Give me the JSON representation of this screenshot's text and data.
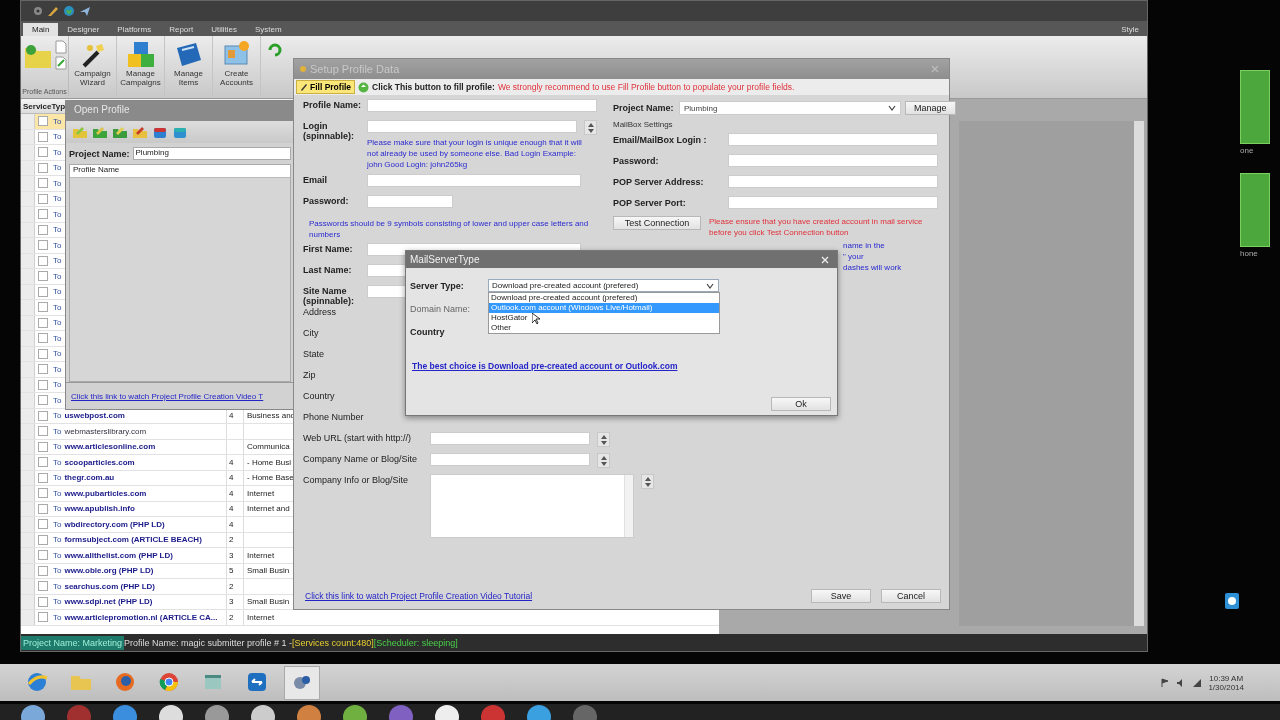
{
  "app": {
    "tabs": [
      {
        "label": "Main",
        "selected": true
      },
      {
        "label": "Designer",
        "selected": false
      },
      {
        "label": "Platforms",
        "selected": false
      },
      {
        "label": "Report",
        "selected": false
      },
      {
        "label": "Utilities",
        "selected": false
      },
      {
        "label": "System",
        "selected": false
      }
    ],
    "style_label": "Style",
    "ribbon": {
      "group_label": "Profile Actions",
      "buttons": [
        {
          "label": "Campaign Wizard"
        },
        {
          "label": "Manage Campaigns"
        },
        {
          "label": "Manage Items"
        },
        {
          "label": "Create Accounts"
        }
      ]
    },
    "grid": {
      "column_1": "ServiceTyp",
      "rows": [
        {
          "prefix": "To",
          "checked": false,
          "selected": true
        },
        {
          "prefix": "To",
          "checked": false,
          "selected": false
        },
        {
          "prefix": "To",
          "checked": false,
          "selected": false
        },
        {
          "prefix": "To",
          "checked": false,
          "selected": false
        },
        {
          "prefix": "To",
          "checked": false,
          "selected": false
        },
        {
          "prefix": "To",
          "checked": false,
          "selected": false
        },
        {
          "prefix": "To",
          "checked": false,
          "selected": false
        },
        {
          "prefix": "To",
          "checked": false,
          "selected": false
        },
        {
          "prefix": "To",
          "checked": false,
          "selected": false
        },
        {
          "prefix": "To",
          "checked": false,
          "selected": false
        },
        {
          "prefix": "To",
          "checked": false,
          "selected": false
        },
        {
          "prefix": "To",
          "checked": false,
          "selected": false
        },
        {
          "prefix": "To",
          "checked": false,
          "selected": false
        },
        {
          "prefix": "To",
          "checked": false,
          "selected": false
        },
        {
          "prefix": "To",
          "checked": false,
          "selected": false
        },
        {
          "prefix": "To",
          "checked": false,
          "selected": false
        },
        {
          "prefix": "To",
          "checked": false,
          "selected": false
        },
        {
          "prefix": "To",
          "checked": false,
          "selected": false
        },
        {
          "prefix": "To",
          "checked": false,
          "selected": false
        },
        {
          "prefix": "To",
          "name": "uswebpost.com",
          "bold": true,
          "count": "4",
          "category": "Business and",
          "checked": false,
          "selected": false
        },
        {
          "prefix": "To",
          "name": "webmasterslibrary.com",
          "bold": false,
          "checked": false,
          "selected": false
        },
        {
          "prefix": "To",
          "name": "www.articlesonline.com",
          "bold": true,
          "category": "Communica",
          "checked": false,
          "selected": false
        },
        {
          "prefix": "To",
          "name": "scooparticles.com",
          "bold": true,
          "count": "4",
          "category": "- Home Busi",
          "checked": false,
          "selected": false
        },
        {
          "prefix": "To",
          "name": "thegr.com.au",
          "bold": true,
          "count": "4",
          "category": "- Home Base",
          "checked": false,
          "selected": false
        },
        {
          "prefix": "To",
          "name": "www.pubarticles.com",
          "bold": true,
          "count": "4",
          "category": "Internet",
          "checked": false,
          "selected": false
        },
        {
          "prefix": "To",
          "name": "www.apublish.info",
          "bold": true,
          "count": "4",
          "category": "Internet and",
          "checked": false,
          "selected": false
        },
        {
          "prefix": "To",
          "name": "wbdirectory.com (PHP LD)",
          "bold": true,
          "count": "4",
          "checked": false,
          "selected": false
        },
        {
          "prefix": "To",
          "name": "formsubject.com (ARTICLE BEACH)",
          "bold": true,
          "count": "2",
          "checked": false,
          "selected": false
        },
        {
          "prefix": "To",
          "name": "www.allthelist.com (PHP LD)",
          "bold": true,
          "count": "3",
          "category": "Internet",
          "checked": false,
          "selected": false
        },
        {
          "prefix": "To",
          "name": "www.oble.org (PHP LD)",
          "bold": true,
          "count": "5",
          "category": "Small Busin",
          "checked": false,
          "selected": false
        },
        {
          "prefix": "To",
          "name": "searchus.com (PHP LD)",
          "bold": true,
          "count": "2",
          "checked": false,
          "selected": false
        },
        {
          "prefix": "To",
          "name": "www.sdpi.net (PHP LD)",
          "bold": true,
          "count": "3",
          "category": "Small Busin",
          "checked": false,
          "selected": false
        },
        {
          "prefix": "To",
          "name": "www.articlepromotion.nl (ARTICLE CA...",
          "bold": true,
          "count": "2",
          "category": "Internet",
          "checked": false,
          "selected": false
        }
      ]
    },
    "status_bar": {
      "project": "Project Name: Marketing",
      "profile": "Profile Name: magic submitter profile # 1 - ",
      "services": "[Services count:480]",
      "scheduler": "[Scheduler: sleeping]"
    }
  },
  "open_profile": {
    "title": "Open Profile",
    "project_label": "Project Name:",
    "project_value": "Plumbing",
    "list_header": "Profile Name",
    "link": "Click this link to watch Project  Profile Creation Video T"
  },
  "setup_profile": {
    "title": "Setup Profile Data",
    "fill_button": "Fill Profile",
    "fill_hint": "Click This button to fill profile:",
    "warning": "We strongly recommend to use Fill Profile button to populate your profile fields.",
    "left_fields": [
      {
        "kind": "text",
        "label": "Profile Name:",
        "bold": true
      },
      {
        "kind": "spin",
        "label": "Login (spinnable):",
        "bold": true,
        "note": "Please make sure that your login is unique enough that it will not already be used by someone else. Bad Login Example: john Good Login: john265kg"
      },
      {
        "kind": "text",
        "label": "Email",
        "bold": true
      },
      {
        "kind": "short",
        "label": "Password:",
        "bold": true
      },
      {
        "kind": "note",
        "label": "Passwords should be 9 symbols consisting of lower and upper case letters and numbers"
      },
      {
        "kind": "text",
        "label": "First Name:",
        "bold": true
      },
      {
        "kind": "text",
        "label": "Last Name:",
        "bold": true
      },
      {
        "kind": "text",
        "label": "Site Name (spinnable):",
        "bold": true
      },
      {
        "kind": "label",
        "label": "Address",
        "bold": false
      },
      {
        "kind": "label",
        "label": "City",
        "bold": false
      },
      {
        "kind": "label",
        "label": "State",
        "bold": false
      },
      {
        "kind": "label",
        "label": "Zip",
        "bold": false
      },
      {
        "kind": "label",
        "label": "Country",
        "bold": false
      },
      {
        "kind": "label",
        "label": "Phone Number",
        "bold": false
      },
      {
        "kind": "url",
        "label": "Web URL (start with http://)",
        "bold": false
      },
      {
        "kind": "url",
        "label": "Company Name or Blog/Site",
        "bold": false
      },
      {
        "kind": "textarea",
        "label": "Company Info or Blog/Site",
        "bold": false
      }
    ],
    "project_label": "Project Name:",
    "project_value": "Plumbing",
    "manage_button": "Manage",
    "mailbox_heading": "MailBox Settings",
    "mail_fields": [
      {
        "label": "Email/MailBox Login :"
      },
      {
        "label": "Password:"
      },
      {
        "label": "POP Server Address:"
      },
      {
        "label": "POP Server Port:"
      }
    ],
    "test_button": "Test Connection",
    "test_note": "Please ensure that you have created account in mail service before you click Test Connection button",
    "hidden_fragments": [
      "name in the",
      "\" your",
      "dashes will work"
    ],
    "link": "Click this link to watch Project  Profile Creation Video Tutorial",
    "save_button": "Save",
    "cancel_button": "Cancel"
  },
  "mail_dialog": {
    "title": "MailServerType",
    "server_label": "Server Type:",
    "server_value": "Download pre-created account (prefered)",
    "options": [
      {
        "label": "Download pre-created account (prefered)",
        "selected": false
      },
      {
        "label": "Outlook.com account (Windows Live/Hotmail)",
        "selected": true
      },
      {
        "label": "HostGator",
        "selected": false
      },
      {
        "label": "Other",
        "selected": false
      }
    ],
    "domain_label": "Domain Name:",
    "country_label": "Country",
    "link": "The best choice is Download pre-created account or Outlook.com",
    "ok_button": "Ok"
  },
  "desktop": {
    "side_labels": [
      "one",
      "hone"
    ]
  },
  "taskbar": {
    "time": "10:39 AM",
    "date": "1/30/2014"
  }
}
